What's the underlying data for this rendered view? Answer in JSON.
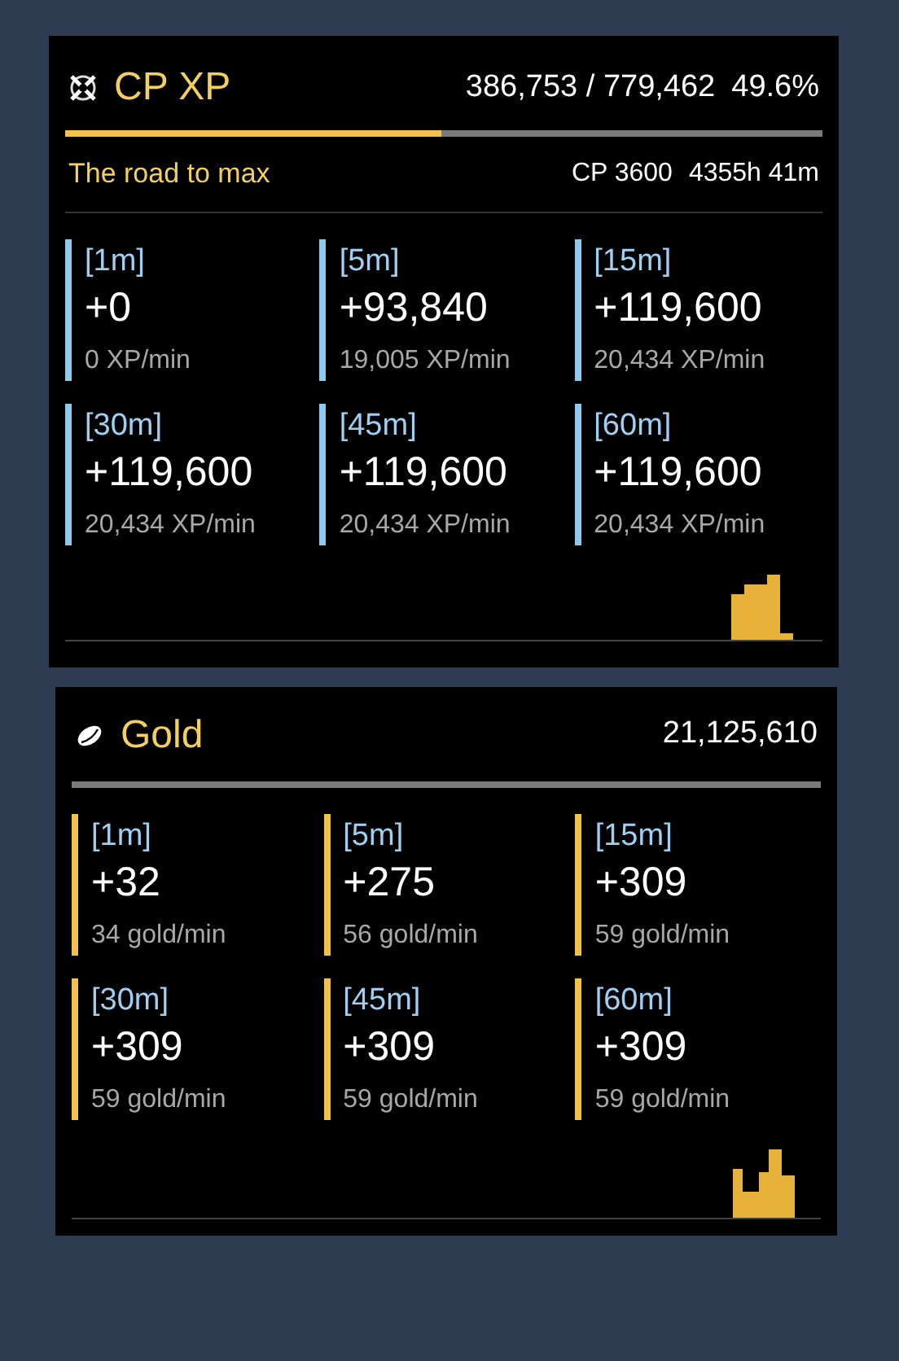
{
  "panels": [
    {
      "kind": "xp",
      "title": "CP XP",
      "total": "386,753 / 779,462",
      "percent": "49.6%",
      "level": 0.496,
      "subtitle": "The road to max",
      "target": "CP 3600",
      "eta": "4355h 41m",
      "color": "#8ec9ee",
      "stats": [
        {
          "interval": "[1m]",
          "gain": "+0",
          "rate": "0 XP/min"
        },
        {
          "interval": "[5m]",
          "gain": "+93,840",
          "rate": "19,005 XP/min"
        },
        {
          "interval": "[15m]",
          "gain": "+119,600",
          "rate": "20,434 XP/min"
        },
        {
          "interval": "[30m]",
          "gain": "+119,600",
          "rate": "20,434 XP/min"
        },
        {
          "interval": "[45m]",
          "gain": "+119,600",
          "rate": "20,434 XP/min"
        },
        {
          "interval": "[60m]",
          "gain": "+119,600",
          "rate": "20,434 XP/min"
        }
      ]
    },
    {
      "kind": "gold",
      "title": "Gold",
      "total": "21,125,610",
      "color": "#f2c14a",
      "stats": [
        {
          "interval": "[1m]",
          "gain": "+32",
          "rate": "34 gold/min"
        },
        {
          "interval": "[5m]",
          "gain": "+275",
          "rate": "56 gold/min"
        },
        {
          "interval": "[15m]",
          "gain": "+309",
          "rate": "59 gold/min"
        },
        {
          "interval": "[30m]",
          "gain": "+309",
          "rate": "59 gold/min"
        },
        {
          "interval": "[45m]",
          "gain": "+309",
          "rate": "59 gold/min"
        },
        {
          "interval": "[60m]",
          "gain": "+309",
          "rate": "59 gold/min"
        }
      ]
    }
  ]
}
